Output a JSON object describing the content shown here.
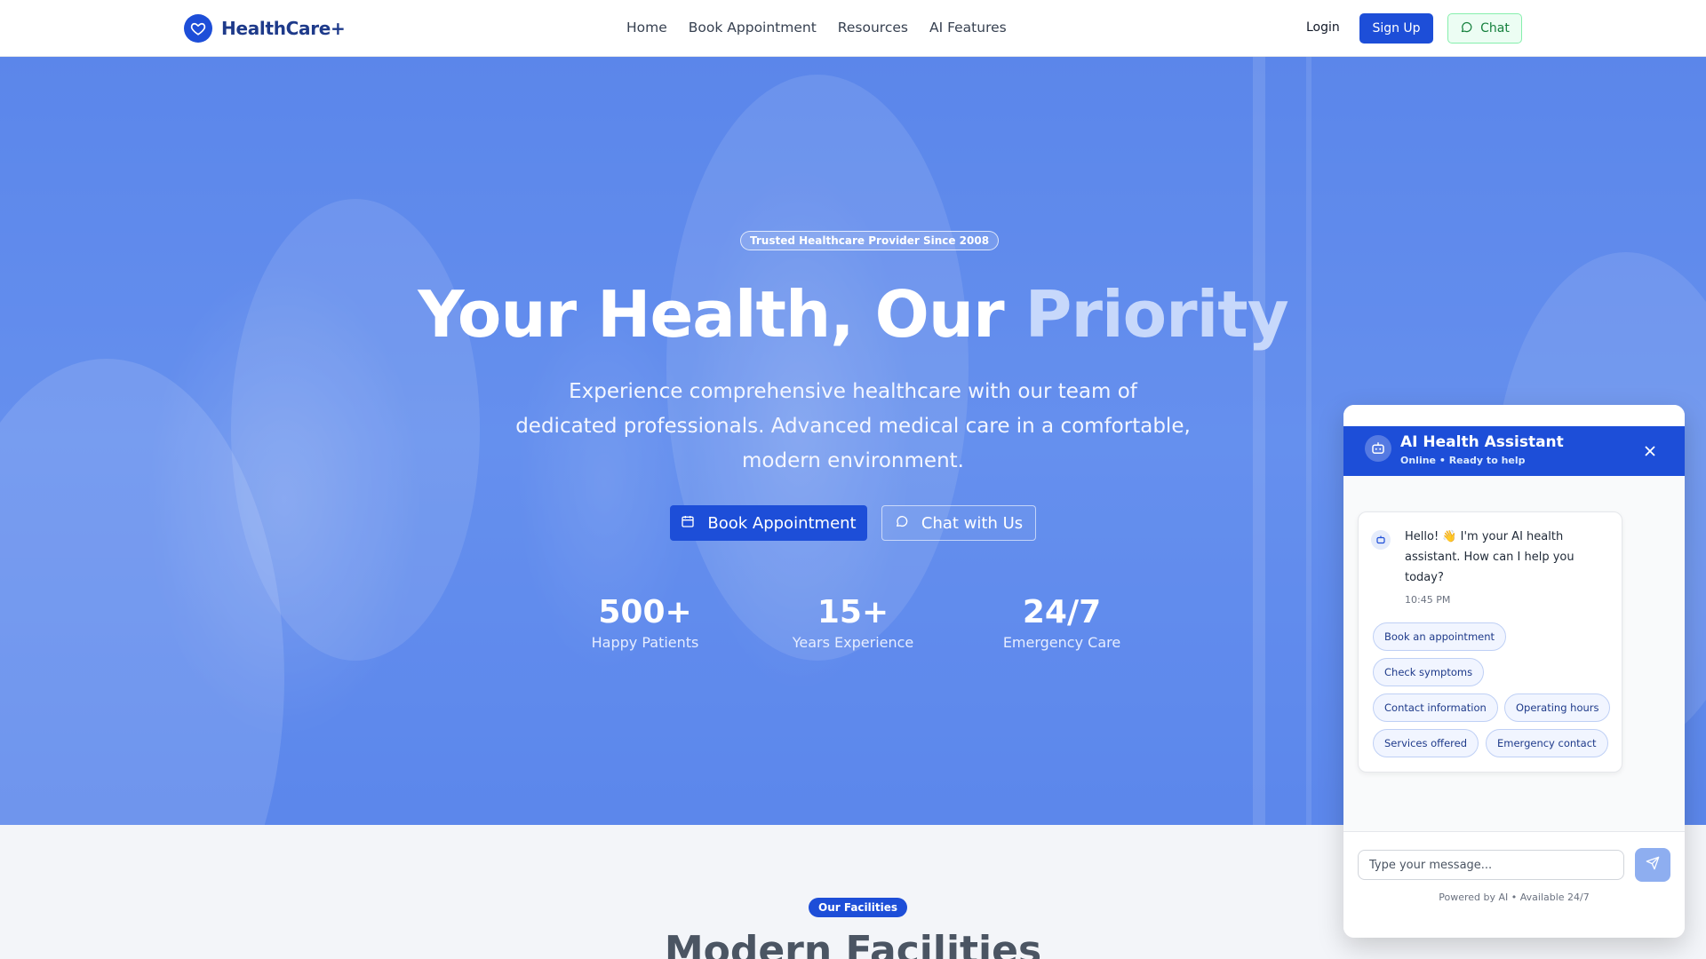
{
  "nav": {
    "brand": "HealthCare+",
    "links": [
      "Home",
      "Book Appointment",
      "Resources",
      "AI Features"
    ],
    "login": "Login",
    "signup": "Sign Up",
    "chat": "Chat"
  },
  "hero": {
    "badge": "Trusted Healthcare Provider Since 2008",
    "title_main": "Your Health, Our ",
    "title_accent": "Priority",
    "subtitle": "Experience comprehensive healthcare with our team of dedicated professionals. Advanced medical care in a comfortable, modern environment.",
    "book_button": "Book Appointment",
    "chat_button": "Chat with Us",
    "stats": [
      {
        "value": "500+",
        "label": "Happy Patients"
      },
      {
        "value": "15+",
        "label": "Years Experience"
      },
      {
        "value": "24/7",
        "label": "Emergency Care"
      }
    ]
  },
  "facilities": {
    "badge": "Our Facilities",
    "title": "Modern Facilities"
  },
  "chat_widget": {
    "title": "AI Health Assistant",
    "status": "Online • Ready to help",
    "message": "Hello! 👋 I'm your AI health assistant. How can I help you today?",
    "time": "10:45 PM",
    "quick_replies": [
      "Book an appointment",
      "Check symptoms",
      "Contact information",
      "Operating hours",
      "Services offered",
      "Emergency contact"
    ],
    "input_placeholder": "Type your message...",
    "footer": "Powered by AI • Available 24/7"
  },
  "colors": {
    "primary": "#1d4ed8",
    "hero_overlay": "#5b86ea",
    "chat_green": "#15803d"
  }
}
